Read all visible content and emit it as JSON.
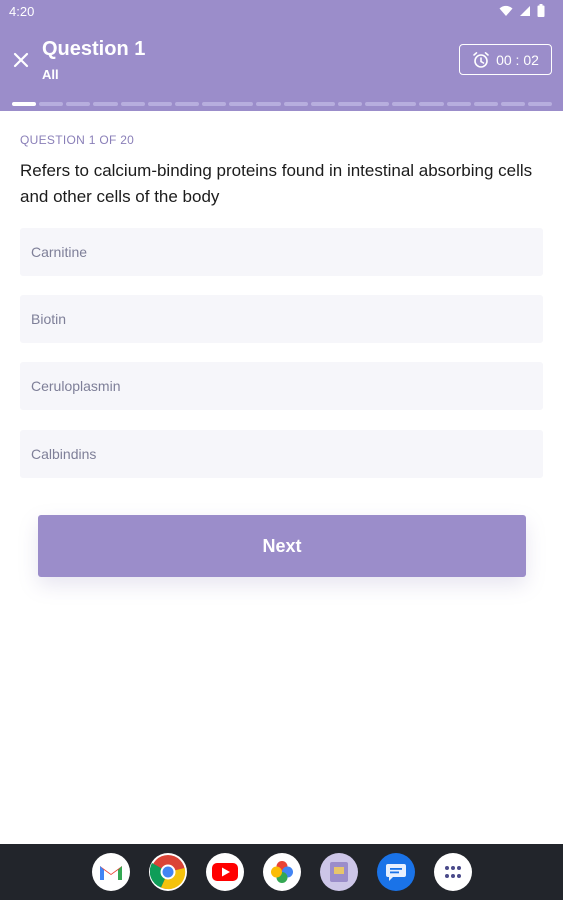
{
  "status_bar": {
    "time": "4:20"
  },
  "header": {
    "title": "Question 1",
    "subtitle": "All",
    "timer": "00 : 02",
    "progress": {
      "total": 20,
      "current": 1
    }
  },
  "question": {
    "counter": "QUESTION 1 OF 20",
    "text": "Refers to calcium-binding proteins found in intestinal absorbing cells and other cells of the body",
    "options": [
      "Carnitine",
      "Biotin",
      "Ceruloplasmin",
      "Calbindins"
    ]
  },
  "next_label": "Next",
  "nav_apps": [
    "gmail-icon",
    "chrome-icon",
    "youtube-icon",
    "photos-icon",
    "app-icon",
    "messages-icon",
    "app-drawer-icon"
  ],
  "colors": {
    "accent": "#9b8dca",
    "option_bg": "#f6f6fa",
    "navbar": "#22252b"
  }
}
